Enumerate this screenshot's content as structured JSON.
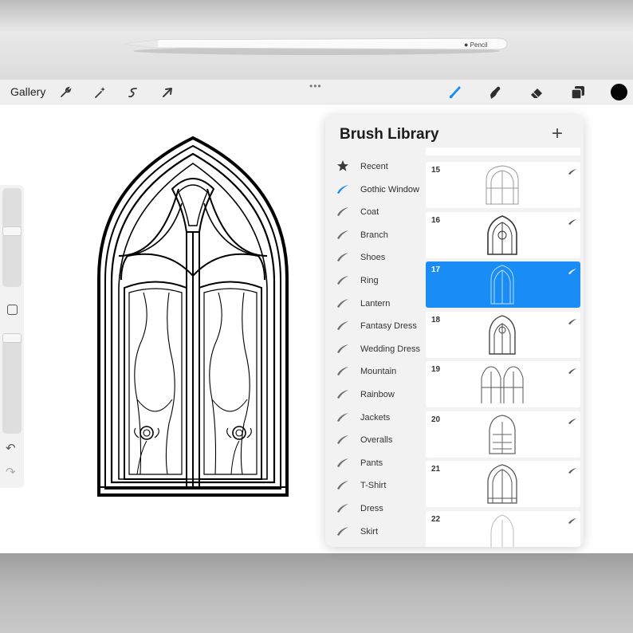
{
  "pencil": {
    "label": "Pencil"
  },
  "toolbar": {
    "gallery_label": "Gallery",
    "tools": [
      "wrench-icon",
      "magic-wand-icon",
      "selection-icon",
      "transform-arrow-icon"
    ],
    "right_tools": [
      "brush-icon",
      "smudge-icon",
      "eraser-icon",
      "layers-icon"
    ],
    "active_tool": "brush-icon",
    "current_color": "#050505",
    "accent_color": "#1a8cf5"
  },
  "brush_library": {
    "title": "Brush Library",
    "add_label": "+",
    "categories": [
      {
        "label": "Recent",
        "icon": "star-icon"
      },
      {
        "label": "Gothic Window",
        "icon": "brush-stroke-icon",
        "active": true
      },
      {
        "label": "Coat",
        "icon": "brush-stroke-icon"
      },
      {
        "label": "Branch",
        "icon": "brush-stroke-icon"
      },
      {
        "label": "Shoes",
        "icon": "brush-stroke-icon"
      },
      {
        "label": "Ring",
        "icon": "brush-stroke-icon"
      },
      {
        "label": "Lantern",
        "icon": "brush-stroke-icon"
      },
      {
        "label": "Fantasy Dress",
        "icon": "brush-stroke-icon"
      },
      {
        "label": "Wedding Dress",
        "icon": "brush-stroke-icon"
      },
      {
        "label": "Mountain",
        "icon": "brush-stroke-icon"
      },
      {
        "label": "Rainbow",
        "icon": "brush-stroke-icon"
      },
      {
        "label": "Jackets",
        "icon": "brush-stroke-icon"
      },
      {
        "label": "Overalls",
        "icon": "brush-stroke-icon"
      },
      {
        "label": "Pants",
        "icon": "brush-stroke-icon"
      },
      {
        "label": "T-Shirt",
        "icon": "brush-stroke-icon"
      },
      {
        "label": "Dress",
        "icon": "brush-stroke-icon"
      },
      {
        "label": "Skirt",
        "icon": "brush-stroke-icon"
      }
    ],
    "brushes": [
      {
        "number": "15"
      },
      {
        "number": "16"
      },
      {
        "number": "17",
        "selected": true
      },
      {
        "number": "18"
      },
      {
        "number": "19"
      },
      {
        "number": "20"
      },
      {
        "number": "21"
      },
      {
        "number": "22"
      }
    ]
  },
  "sidebar": {
    "icons": [
      "modify-square-icon",
      "undo-icon",
      "redo-icon"
    ],
    "undo_glyph": "↶",
    "redo_glyph": "↷"
  }
}
